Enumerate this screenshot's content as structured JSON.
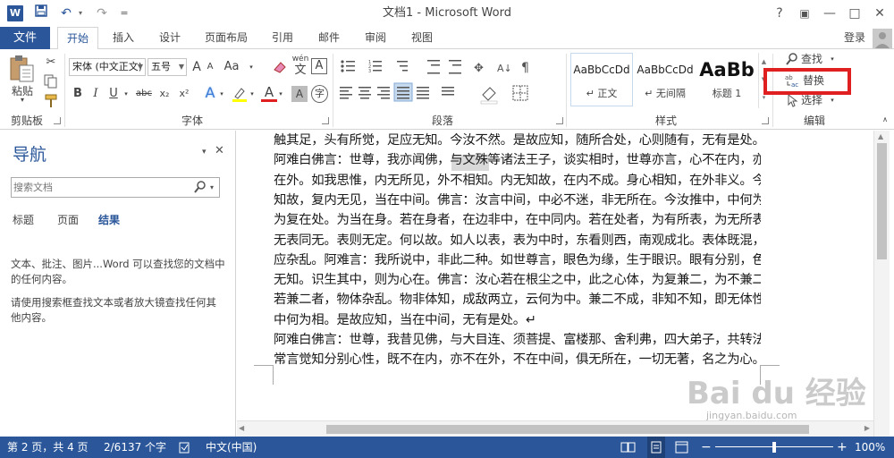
{
  "titlebar": {
    "title": "文档1 - Microsoft Word",
    "help": "?",
    "min": "—",
    "restore": "□",
    "close": "✕"
  },
  "qat": {
    "undo": "↶",
    "redo": "↷",
    "custom": "="
  },
  "tabs": {
    "file": "文件",
    "items": [
      "开始",
      "插入",
      "设计",
      "页面布局",
      "引用",
      "邮件",
      "审阅",
      "视图"
    ],
    "login": "登录"
  },
  "ribbon": {
    "clipboard": {
      "paste": "粘贴",
      "label": "剪贴板"
    },
    "font": {
      "font_name": "宋体 (中文正文)",
      "font_size": "五号",
      "label": "字体",
      "grow": "A",
      "shrink": "A",
      "case": "Aa",
      "wen": "wén",
      "bold": "B",
      "italic": "I",
      "underline": "U",
      "strike": "abc",
      "sub": "x₂",
      "sup": "x²",
      "effects": "A",
      "highlight": "ab",
      "color": "A",
      "boxA": "A"
    },
    "paragraph": {
      "label": "段落"
    },
    "styles": {
      "label": "样式",
      "items": [
        {
          "preview": "AaBbCcDd",
          "name": "↵ 正文"
        },
        {
          "preview": "AaBbCcDd",
          "name": "↵ 无间隔"
        },
        {
          "preview": "AaBb",
          "name": "标题 1"
        }
      ]
    },
    "editing": {
      "find": "查找",
      "replace": "替换",
      "select": "选择",
      "label": "编辑"
    }
  },
  "nav": {
    "title": "导航",
    "search_placeholder": "搜索文档",
    "tabs": [
      "标题",
      "页面",
      "结果"
    ],
    "desc1": "文本、批注、图片...Word 可以查找您的文档中的任何内容。",
    "desc2": "请使用搜索框查找文本或者放大镜查找任何其他内容。"
  },
  "document": {
    "lines": [
      "触其足，头有所觉，足应无知。今汝不然。是故应知，随所合处，心则随有，无有是处。↵",
      "阿难白佛言：世尊，我亦闻佛，与文殊等诸法王子，谈实相时，世尊亦言，心不在内，亦不",
      "在外。如我思惟，内无所见，外不相知。内无知故，在内不成。身心相知，在外非义。今相",
      "知故，复内无见，当在中间。佛言：汝言中间，中必不迷，非无所在。今汝推中，中何为在。",
      "为复在处。为当在身。若在身者，在边非中，在中同内。若在处者，为有所表，为无所表。",
      "无表同无。表则无定。何以故。如人以表，表为中时，东看则西，南观成北。表体既混，心",
      "应杂乱。阿难言：我所说中，非此二种。如世尊言，眼色为缘，生于眼识。眼有分别，色尘",
      "无知。识生其中，则为心在。佛言：汝心若在根尘之中，此之心体，为复兼二，为不兼二。",
      "若兼二者，物体杂乱。物非体知，成敌两立，云何为中。兼二不成，非知不知，即无体性，",
      "中何为相。是故应知，当在中间，无有是处。↵",
      "阿难白佛言：世尊，我昔见佛，与大目连、须菩提、富楼那、舍利弗，四大弟子，共转法轮。",
      "常言觉知分别心性，既不在内，亦不在外，不在中间，俱无所在，一切无著，名之为心。则"
    ]
  },
  "status": {
    "page": "第 2 页，共 4 页",
    "words": "2/6137 个字",
    "lang": "中文(中国)",
    "zoom": "100%",
    "minus": "−",
    "plus": "+"
  },
  "watermark": {
    "brand": "Bai du 经验",
    "url": "jingyan.baidu.com"
  },
  "colors": {
    "accent": "#2b579a",
    "highlight_box": "#e02020"
  }
}
